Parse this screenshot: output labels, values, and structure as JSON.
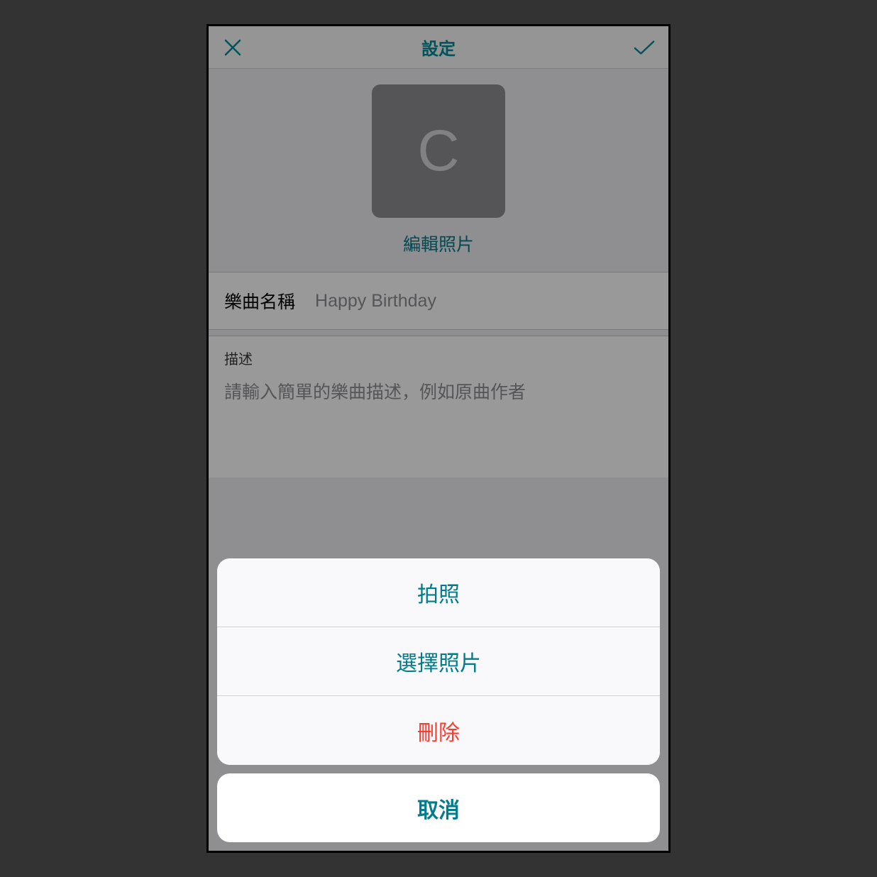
{
  "header": {
    "title": "設定"
  },
  "photo": {
    "letter": "C",
    "edit_label": "編輯照片"
  },
  "form": {
    "song_name_label": "樂曲名稱",
    "song_name_value": "Happy Birthday",
    "description_label": "描述",
    "description_placeholder": "請輸入簡單的樂曲描述，例如原曲作者"
  },
  "action_sheet": {
    "take_photo": "拍照",
    "choose_photo": "選擇照片",
    "delete": "刪除",
    "cancel": "取消"
  }
}
